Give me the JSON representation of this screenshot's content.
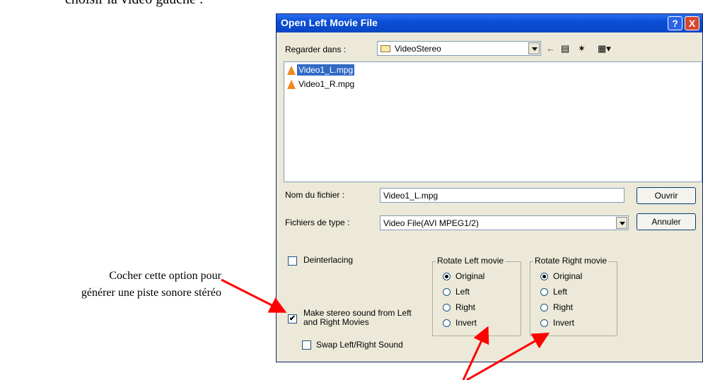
{
  "document": {
    "top_caption": "choisir la vidéo gauche :",
    "callout_line1": "Cocher cette option pour",
    "callout_line2": "générer une piste sonore stéréo"
  },
  "dialog": {
    "title": "Open Left Movie File",
    "help_label": "?",
    "close_label": "X",
    "look_in_label": "Regarder dans :",
    "look_in_value": "VideoStereo",
    "files": [
      "Video1_L.mpg",
      "Video1_R.mpg"
    ],
    "selected_file": "Video1_L.mpg",
    "filename_label": "Nom du fichier :",
    "filename_value": "Video1_L.mpg",
    "filetype_label": "Fichiers de type :",
    "filetype_value": "Video File(AVI MPEG1/2)",
    "open_button": "Ouvrir",
    "cancel_button": "Annuler",
    "deinterlacing_label": "Deinterlacing",
    "deinterlacing_checked": false,
    "stereo_sound_label": "Make stereo sound from Left and Right Movies",
    "stereo_sound_checked": true,
    "swap_sound_label": "Swap Left/Right Sound",
    "swap_sound_checked": false,
    "rotate_left": {
      "title": "Rotate Left movie",
      "options": [
        "Original",
        "Left",
        "Right",
        "Invert"
      ],
      "selected": "Original"
    },
    "rotate_right": {
      "title": "Rotate Right movie",
      "options": [
        "Original",
        "Left",
        "Right",
        "Invert"
      ],
      "selected": "Original"
    }
  },
  "annotation_color": "#ff0000",
  "titlebar_color": "#0a46c4",
  "icons": {
    "folder": "folder-icon",
    "back": "back-arrow-icon",
    "up": "up-folder-icon",
    "new_folder": "new-folder-icon",
    "view_menu": "view-menu-icon",
    "file": "vlc-cone-icon"
  }
}
